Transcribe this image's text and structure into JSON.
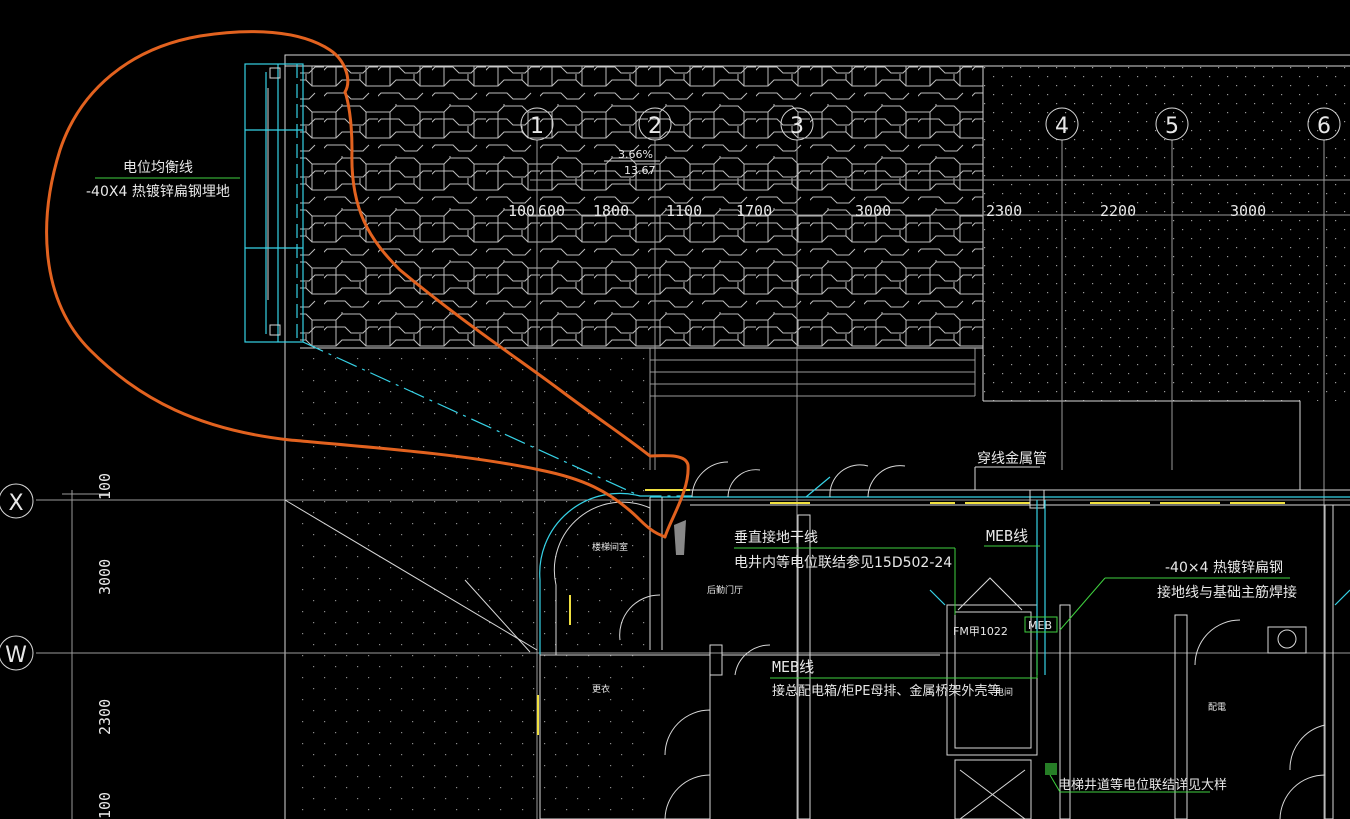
{
  "axes": {
    "vertical": [
      "1",
      "2",
      "3",
      "4",
      "5",
      "6"
    ],
    "horizontal": [
      "X",
      "W"
    ]
  },
  "dimensions": {
    "top": [
      "100",
      "600",
      "1800",
      "1100",
      "1700",
      "3000",
      "2300",
      "2200",
      "3000"
    ],
    "left": [
      "100",
      "3000",
      "2300",
      "100"
    ]
  },
  "slope": {
    "percent": "3.66%",
    "elevation": "13.67"
  },
  "labels": {
    "equipotential_line": "电位均衡线",
    "ground_steel": "-40X4 热镀锌扁钢埋地",
    "metal_conduit": "穿线金属管",
    "vertical_ground": "垂直接地干线",
    "shaft_bonding": "电井内等电位联结参见15D502-24",
    "meb_line_1": "MEB线",
    "steel_strip": "-40×4 热镀锌扁钢",
    "foundation_weld": "接地线与基础主筋焊接",
    "fire_door": "FM甲1022",
    "meb_box": "MEB",
    "meb_line_2": "MEB线",
    "pe_connect": "接总配电箱/柜PE母排、金属桥架外壳等",
    "elevator_bonding": "电梯井道等电位联结详见大样",
    "room_stair": "楼梯间室",
    "room_lobby": "后勤门厅",
    "room_change": "更衣",
    "room_elec": "电间",
    "room_dist": "配電"
  },
  "colors": {
    "background": "#000000",
    "lines": "#d8d8d8",
    "ground_wire": "#36d2e6",
    "leader": "#3fd13f",
    "markup": "#e2621f",
    "door_panel": "#f0e040"
  }
}
